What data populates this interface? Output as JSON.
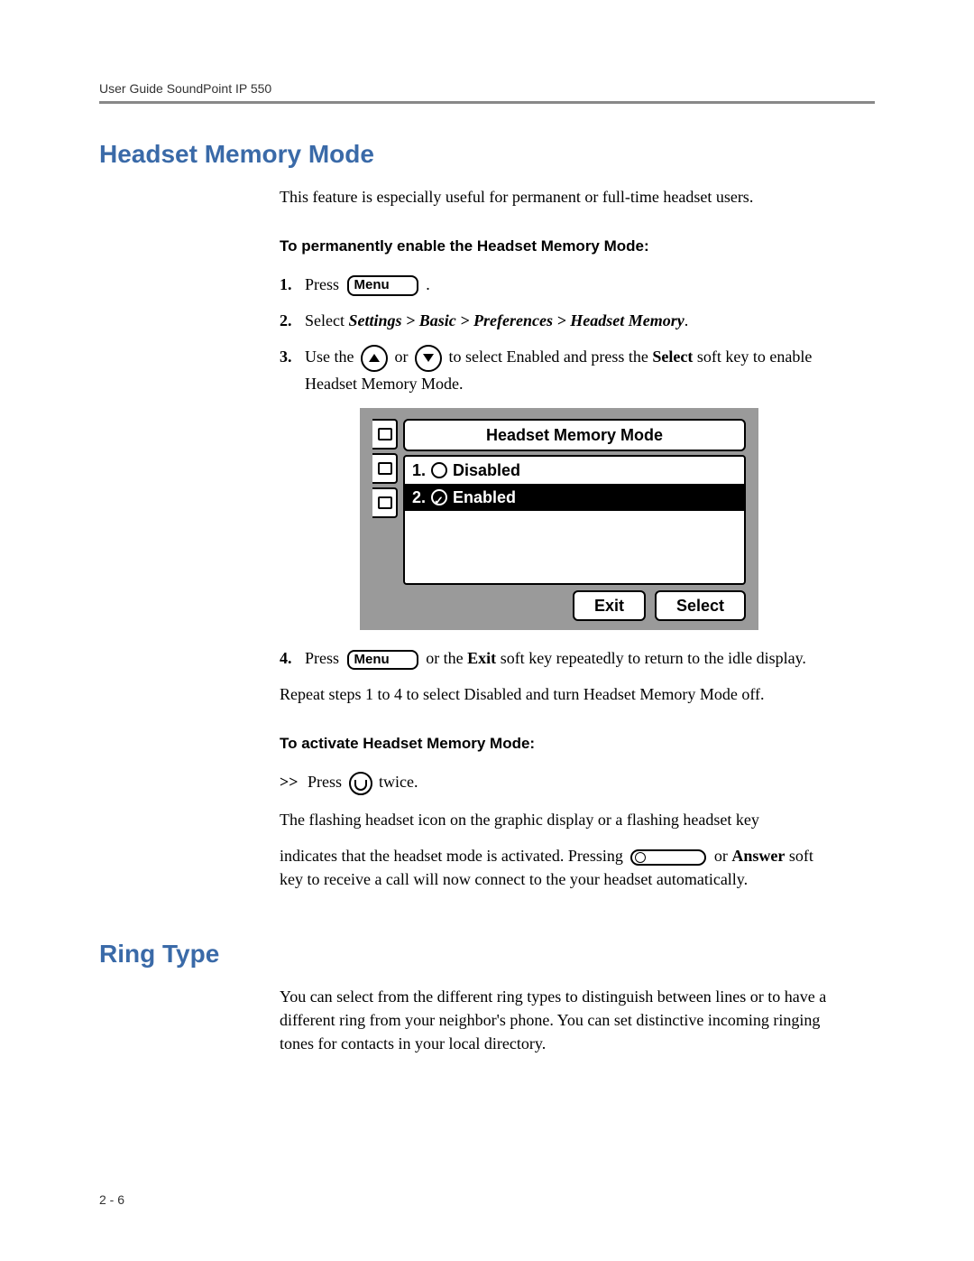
{
  "header": {
    "running_head": "User Guide SoundPoint IP 550"
  },
  "section1": {
    "title": "Headset Memory Mode",
    "intro": "This feature is especially useful for permanent or full-time headset users.",
    "subhead": "To permanently enable the Headset Memory Mode:",
    "steps": {
      "s1_num": "1.",
      "s1_pre": "Press ",
      "menu_label": "Menu",
      "s1_post": " .",
      "s2_num": "2.",
      "s2_pre": "Select ",
      "s2_path": "Settings > Basic > Preferences > Headset Memory",
      "s2_post": ".",
      "s3_num": "3.",
      "s3_a": "Use the ",
      "s3_b": " or ",
      "s3_c": " to select Enabled and press the ",
      "s3_select": "Select",
      "s3_d": " soft key to enable Headset Memory Mode.",
      "s4_num": "4.",
      "s4_a": "Press ",
      "s4_b": " or the ",
      "s4_exit": "Exit",
      "s4_c": " soft key repeatedly to return to the idle display.",
      "repeat": "Repeat steps 1 to 4 to select Disabled and turn Headset Memory Mode off."
    },
    "lcd": {
      "title": "Headset Memory Mode",
      "opt1_num": "1.",
      "opt1_label": "Disabled",
      "opt2_num": "2.",
      "opt2_label": "Enabled",
      "soft_exit": "Exit",
      "soft_select": "Select"
    },
    "activate": {
      "subhead": "To activate Headset Memory Mode:",
      "chev": ">>",
      "a1": " Press ",
      "a2": " twice.",
      "line2": "The flashing headset icon on the graphic display or a flashing headset key",
      "line3a": "indicates that the headset mode is activated. Pressing ",
      "line3b": " or ",
      "line3_answer": "Answer",
      "line3c": " soft key to receive a call will now connect to the your headset automatically."
    }
  },
  "section2": {
    "title": "Ring Type",
    "body": "You can select from the different ring types to distinguish between lines or to have a different ring from your neighbor's phone. You can set distinctive incoming ringing tones for contacts in your local directory."
  },
  "footer": {
    "page": "2 - 6"
  }
}
